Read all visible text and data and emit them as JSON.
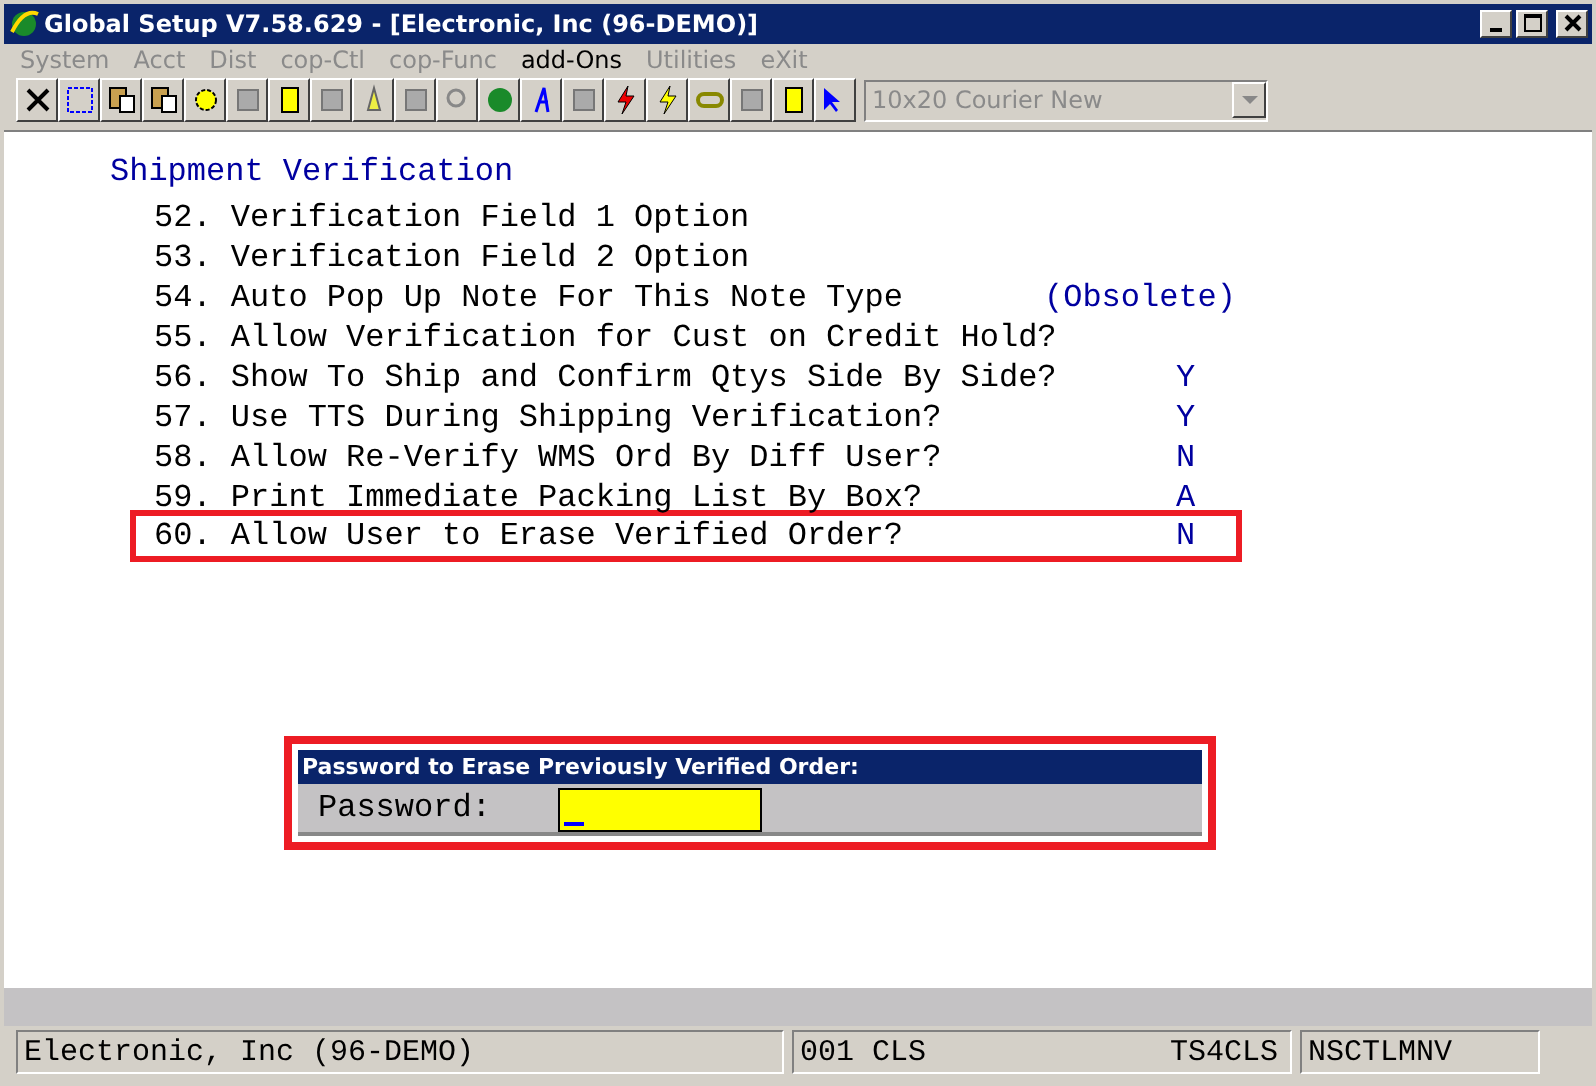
{
  "window": {
    "title": "Global Setup V7.58.629 - [Electronic, Inc (96-DEMO)]"
  },
  "menu": [
    {
      "label": "System",
      "disabled": true
    },
    {
      "label": "Acct",
      "disabled": true
    },
    {
      "label": "Dist",
      "disabled": true
    },
    {
      "label": "cop-Ctl",
      "disabled": true
    },
    {
      "label": "cop-Func",
      "disabled": true
    },
    {
      "label": "add-Ons",
      "disabled": false
    },
    {
      "label": "Utilities",
      "disabled": true
    },
    {
      "label": "eXit",
      "disabled": true
    }
  ],
  "toolbar": {
    "font_dropdown": {
      "value": "10x20 Courier New",
      "disabled": true
    }
  },
  "section": {
    "title": "Shipment Verification",
    "rows": [
      {
        "number": "52.",
        "label": "Verification Field 1 Option",
        "highlighted": false
      },
      {
        "number": "53.",
        "label": "Verification Field 2 Option",
        "highlighted": false
      },
      {
        "number": "54.",
        "label": "Auto Pop Up Note For This Note Type",
        "value": "(Obsolete)",
        "highlighted": false
      },
      {
        "number": "55.",
        "label": "Allow Verification for Cust on Credit Hold?",
        "highlighted": false
      },
      {
        "number": "56.",
        "label": "Show To Ship and Confirm Qtys Side By Side?",
        "value": "Y",
        "highlighted": false
      },
      {
        "number": "57.",
        "label": "Use TTS During Shipping Verification?",
        "value": "Y",
        "highlighted": false
      },
      {
        "number": "58.",
        "label": "Allow Re-Verify WMS Ord By Diff User?",
        "value": "N",
        "highlighted": false
      },
      {
        "number": "59.",
        "label": "Print Immediate Packing List By Box?",
        "value": "A",
        "highlighted": false
      },
      {
        "number": "60.",
        "label": "Allow User to Erase Verified Order?",
        "value": "N",
        "highlighted": true
      }
    ]
  },
  "password_dialog": {
    "title": "Password to Erase Previously Verified Order:",
    "label": "Password:",
    "highlighted": true
  },
  "status_bar": {
    "company": "Electronic, Inc (96-DEMO)",
    "code": "001 CLS",
    "terminal": "TS4CLS",
    "program": "NSCTLMNV"
  }
}
